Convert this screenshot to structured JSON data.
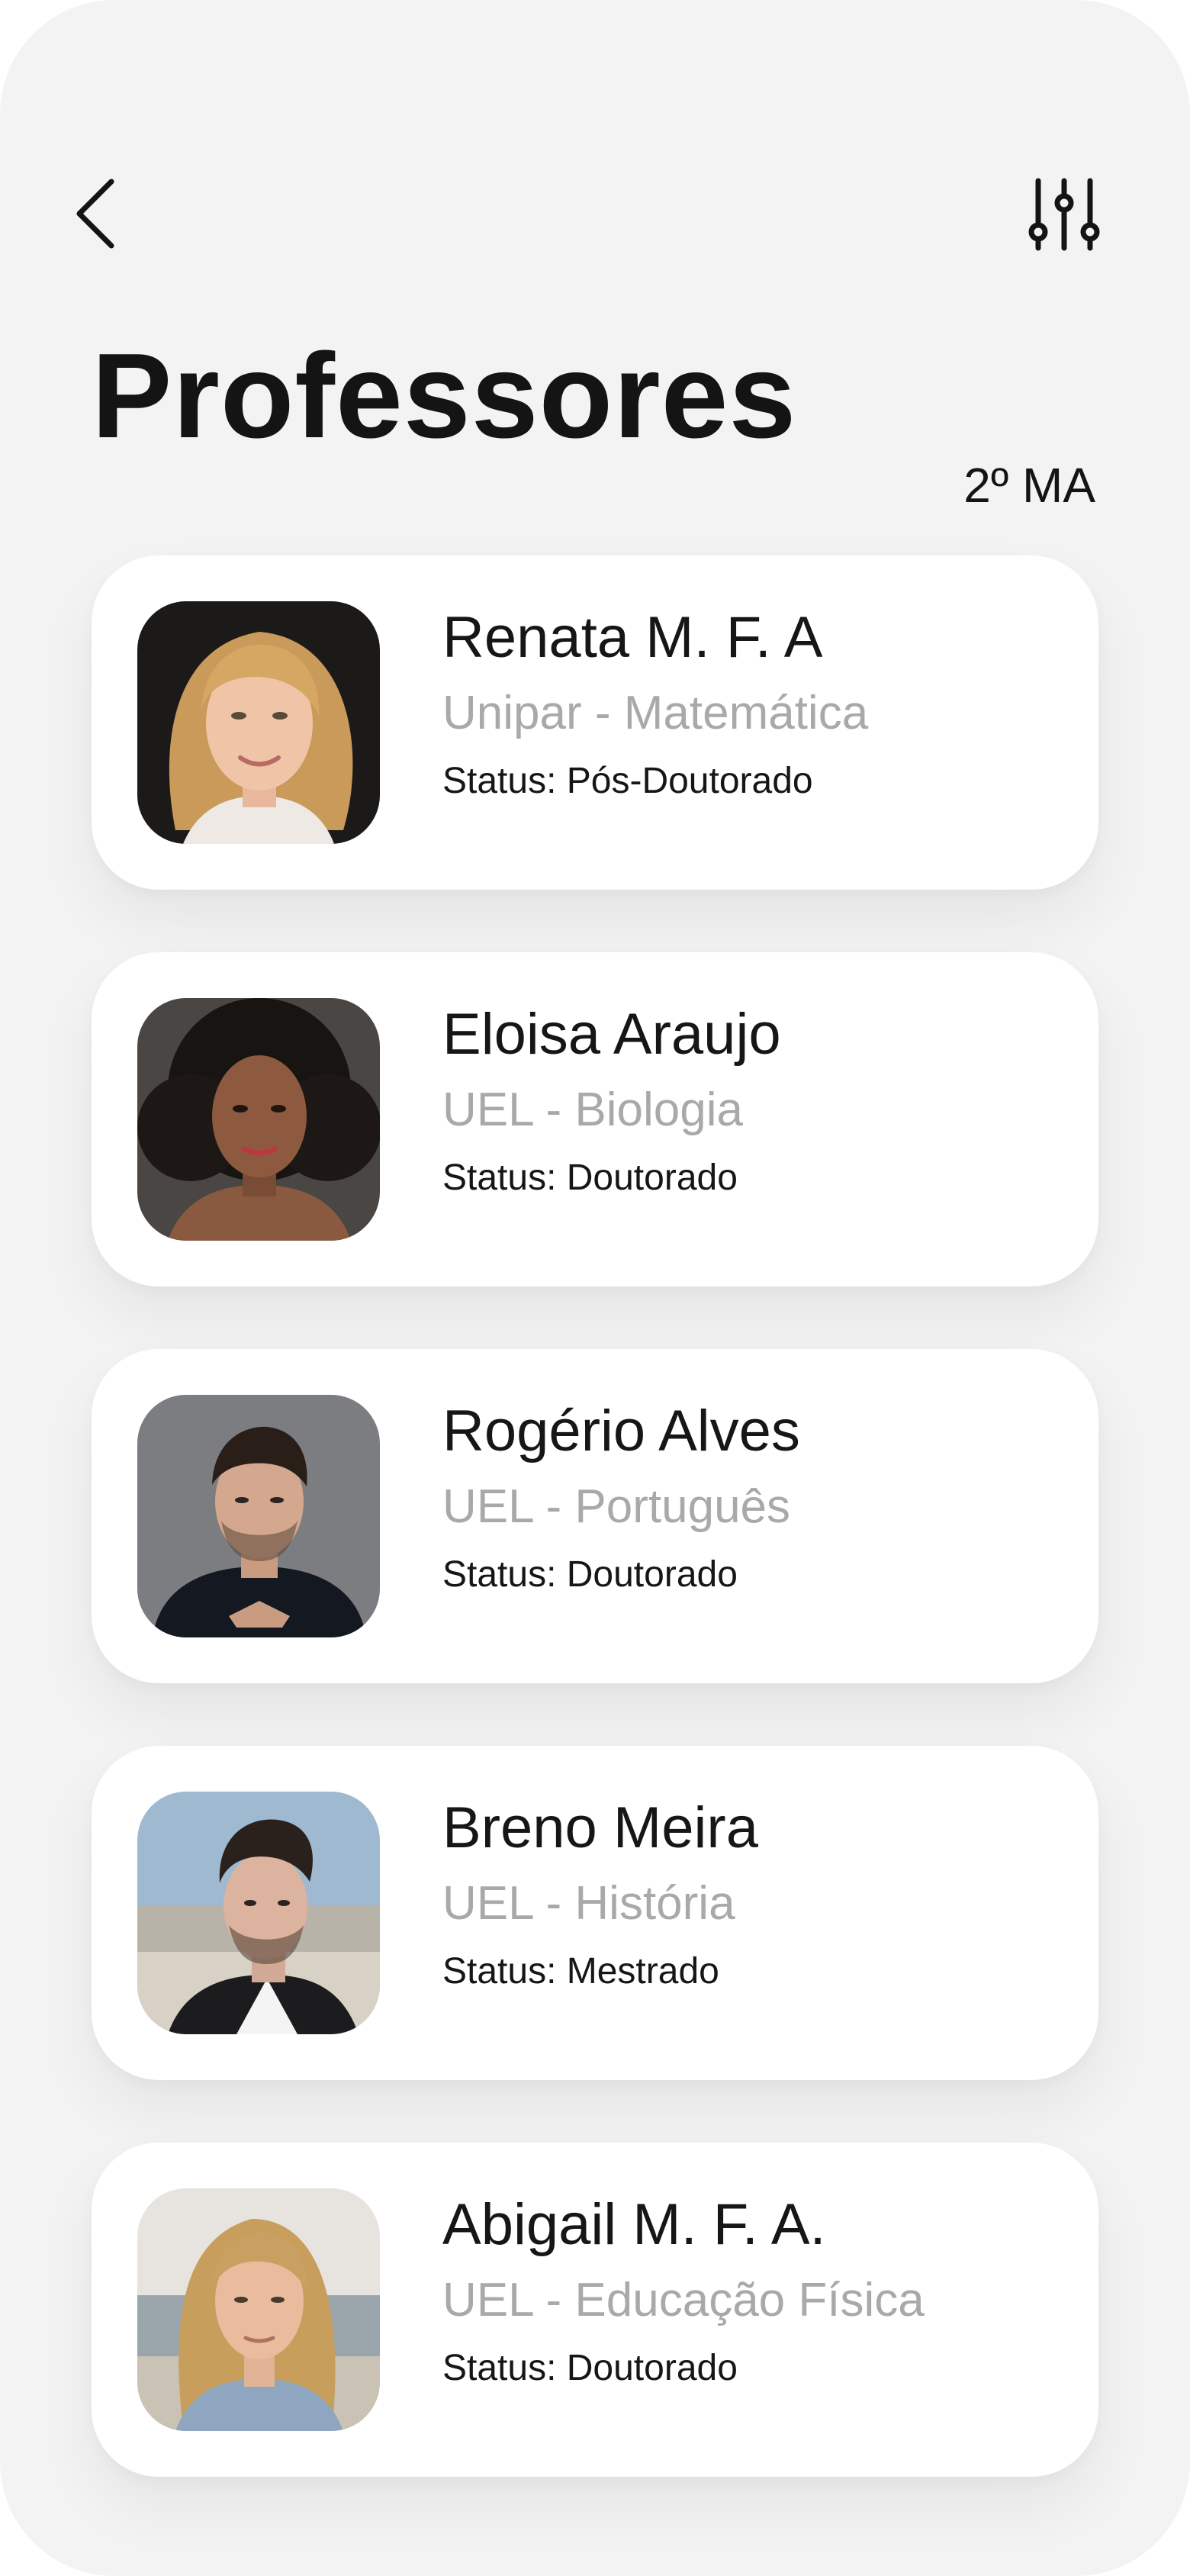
{
  "header": {
    "back_icon": "chevron-left-icon",
    "filter_icon": "sliders-icon"
  },
  "title": "Professores",
  "class_label": "2º MA",
  "teachers": [
    {
      "name": "Renata M. F. A",
      "subject": "Unipar - Matemática",
      "status": "Status: Pós-Doutorado"
    },
    {
      "name": "Eloisa Araujo",
      "subject": "UEL - Biologia",
      "status": "Status: Doutorado"
    },
    {
      "name": "Rogério Alves",
      "subject": "UEL - Português",
      "status": "Status: Doutorado"
    },
    {
      "name": "Breno Meira",
      "subject": "UEL - História",
      "status": "Status: Mestrado"
    },
    {
      "name": "Abigail M. F. A.",
      "subject": "UEL - Educação Física",
      "status": "Status: Doutorado"
    }
  ]
}
